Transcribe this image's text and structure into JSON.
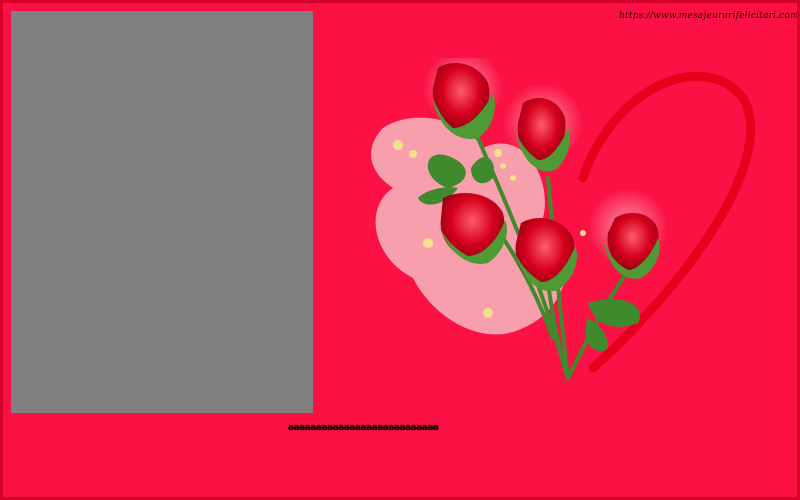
{
  "card": {
    "background_color": "#fb1144",
    "photo_placeholder_color": "#808080",
    "website_text": "https://www.mesajeurarifelicitari.com",
    "message_text": "aaaaaaaaaaaaaaaaaaaaaaaaaaa"
  },
  "artwork": {
    "subject": "red-roses-with-heart",
    "rose_color": "#c4001c",
    "leaf_color": "#3e8a2c",
    "heart_color": "#e5001c"
  }
}
